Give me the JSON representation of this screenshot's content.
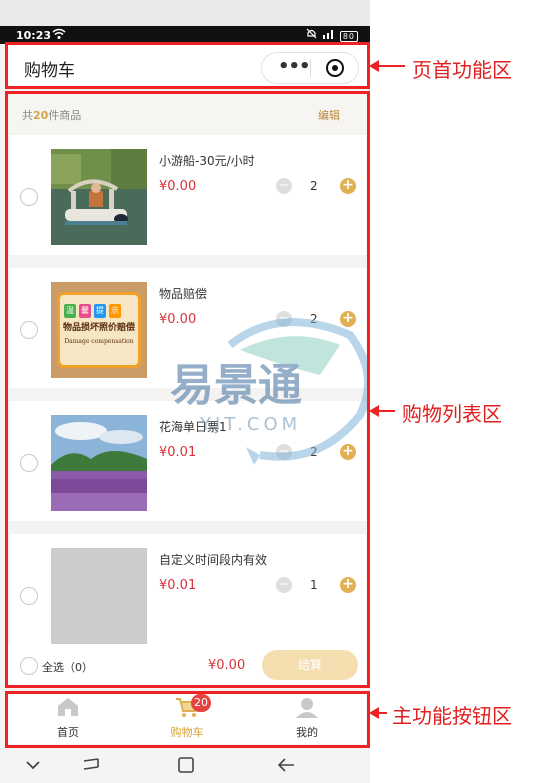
{
  "status_bar": {
    "time": "10:23",
    "battery": "80"
  },
  "header": {
    "title": "购物车"
  },
  "cart": {
    "count_prefix": "共",
    "count": "20",
    "count_suffix": "件商品",
    "edit_label": "编辑",
    "items": [
      {
        "name": "小游船-30元/小时",
        "price": "¥0.00",
        "quantity": "2"
      },
      {
        "name": "物品赔偿",
        "price": "¥0.00",
        "quantity": "2"
      },
      {
        "name": "花海单日票1",
        "price": "¥0.01",
        "quantity": "2"
      },
      {
        "name": "自定义时间段内有效",
        "price": "¥0.01",
        "quantity": "1"
      }
    ],
    "select_all_label": "全选（0）",
    "total": "¥0.00",
    "checkout_label": "结算"
  },
  "sign_image": {
    "line1": [
      "温",
      "馨",
      "提",
      "示"
    ],
    "line2": "物品损坏照价赔偿",
    "line3": "Damage compensation"
  },
  "tabbar": {
    "tabs": [
      {
        "label": "首页",
        "icon": "home-icon"
      },
      {
        "label": "购物车",
        "icon": "cart-icon",
        "badge": "20"
      },
      {
        "label": "我的",
        "icon": "user-icon"
      }
    ]
  },
  "annotations": {
    "header_label": "页首功能区",
    "list_label": "购物列表区",
    "tabbar_label": "主功能按钮区"
  },
  "watermark": {
    "title": "易景通",
    "url": "YJT.COM"
  },
  "colors": {
    "accent": "#e0b053",
    "price": "#d8333b",
    "annotation": "#ee2222",
    "badge": "#e64340"
  }
}
